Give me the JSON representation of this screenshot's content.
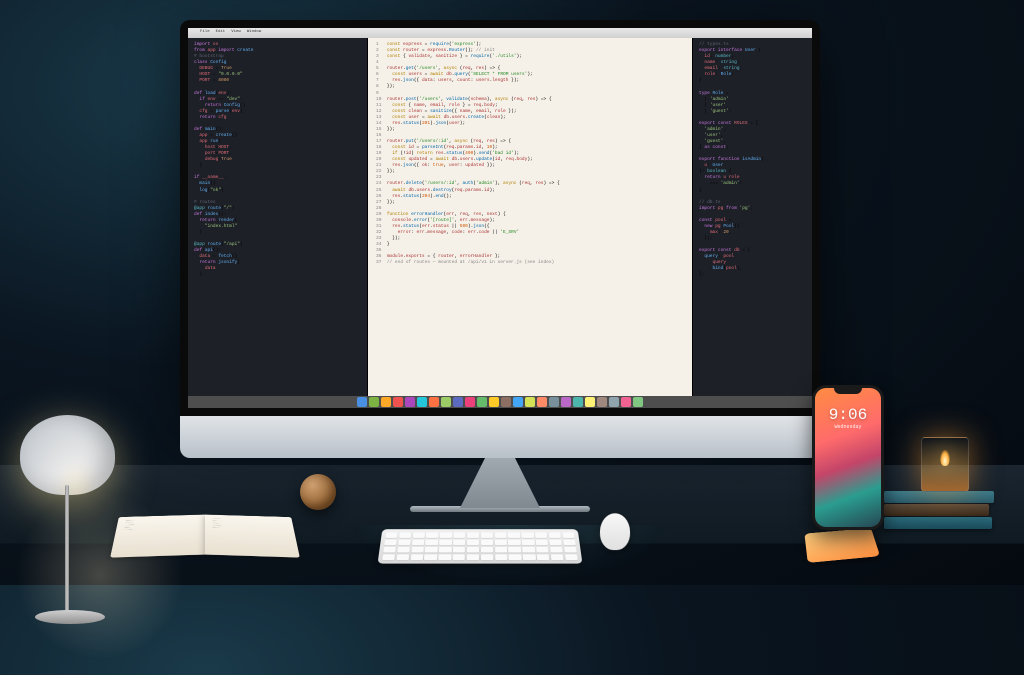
{
  "scene": {
    "description": "Stylized developer workspace photograph with iMac, iPhone, lamp, books, keyboard, mouse and candle",
    "monitor_brand_glyph": ""
  },
  "iphone": {
    "time": "9:06",
    "date": "Wednesday"
  },
  "dock_colors": [
    "#4a90e2",
    "#7cb342",
    "#ffa726",
    "#ef5350",
    "#ab47bc",
    "#26c6da",
    "#ff7043",
    "#9ccc65",
    "#5c6bc0",
    "#ec407a",
    "#66bb6a",
    "#ffca28",
    "#8d6e63",
    "#42a5f5",
    "#d4e157",
    "#ff8a65",
    "#78909c",
    "#ba68c8",
    "#4db6ac",
    "#fff176",
    "#a1887f",
    "#90a4ae",
    "#f06292",
    "#81c784"
  ]
}
